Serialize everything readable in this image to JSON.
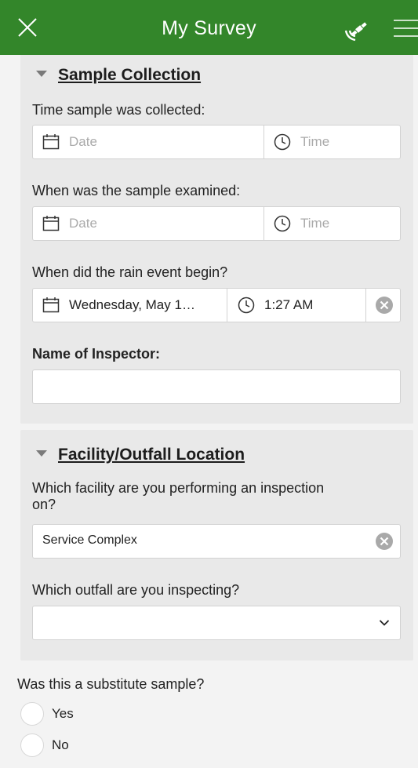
{
  "header": {
    "title": "My Survey",
    "close_icon": "close-icon",
    "gps_icon": "satellite-icon",
    "menu_icon": "hamburger-menu-icon",
    "background": "#33862a"
  },
  "sample_collection": {
    "title": "Sample Collection",
    "time_collected": {
      "label": "Time sample was collected:",
      "date_placeholder": "Date",
      "time_placeholder": "Time"
    },
    "time_examined": {
      "label": "When was the sample examined:",
      "date_placeholder": "Date",
      "time_placeholder": "Time"
    },
    "rain_event": {
      "label": "When did the rain event begin?",
      "date_value": "Wednesday, May 1…",
      "time_value": "1:27 AM"
    },
    "inspector": {
      "label": "Name of Inspector:",
      "value": ""
    }
  },
  "facility": {
    "title": "Facility/Outfall Location",
    "facility_question": {
      "label_line1": "Which facility are you performing an inspection",
      "label_line2": "on?",
      "value": "Service Complex"
    },
    "outfall_question": {
      "label": "Which outfall are you inspecting?",
      "value": ""
    }
  },
  "substitute": {
    "label": "Was this a substitute sample?",
    "options": [
      "Yes",
      "No"
    ]
  }
}
